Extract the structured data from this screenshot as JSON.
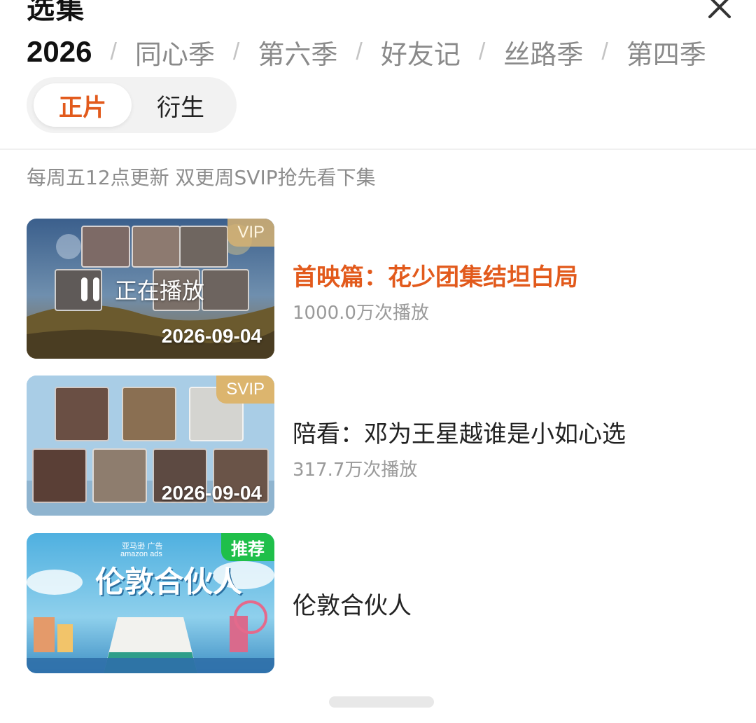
{
  "header": {
    "title": "选集"
  },
  "season_tabs": [
    {
      "label": "2026",
      "active": true
    },
    {
      "label": "同心季",
      "active": false
    },
    {
      "label": "第六季",
      "active": false
    },
    {
      "label": "好友记",
      "active": false
    },
    {
      "label": "丝路季",
      "active": false
    },
    {
      "label": "第四季",
      "active": false
    }
  ],
  "tab_separator": "/",
  "segment": {
    "main_label": "正片",
    "spinoff_label": "衍生"
  },
  "update_note": "每周五12点更新 双更周SVIP抢先看下集",
  "episodes": [
    {
      "title": "首映篇：花少团集结坦白局",
      "views": "1000.0万次播放",
      "badge": "VIP",
      "date": "2026-09-04",
      "playing_label": "正在播放",
      "is_current": true
    },
    {
      "title": "陪看：邓为王星越谁是小如心选",
      "views": "317.7万次播放",
      "badge": "SVIP",
      "date": "2026-09-04",
      "is_current": false
    },
    {
      "title": "伦敦合伙人",
      "badge": "推荐",
      "thumb_caption": "伦敦合伙人",
      "thumb_sponsor": "亚马逊 广告",
      "thumb_sponsor_en": "amazon ads",
      "is_current": false
    }
  ],
  "colors": {
    "accent": "#e25a1c",
    "vip_badge": "#d6b272",
    "recommend_badge": "#1fbf4a"
  }
}
